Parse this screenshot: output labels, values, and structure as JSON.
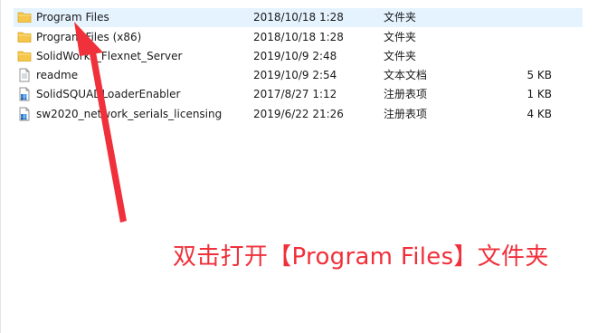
{
  "files": [
    {
      "name": "Program Files",
      "date": "2018/10/18 1:28",
      "type": "文件夹",
      "size": "",
      "icon": "folder-icon",
      "selected": true
    },
    {
      "name": "Program Files (x86)",
      "date": "2018/10/18 1:28",
      "type": "文件夹",
      "size": "",
      "icon": "folder-icon"
    },
    {
      "name": "SolidWorks_Flexnet_Server",
      "date": "2019/10/9 2:48",
      "type": "文件夹",
      "size": "",
      "icon": "folder-icon"
    },
    {
      "name": "readme",
      "date": "2019/10/9 2:54",
      "type": "文本文档",
      "size": "5 KB",
      "icon": "text-file-icon"
    },
    {
      "name": "SolidSQUADLoaderEnabler",
      "date": "2017/8/27 1:12",
      "type": "注册表项",
      "size": "1 KB",
      "icon": "registry-file-icon"
    },
    {
      "name": "sw2020_network_serials_licensing",
      "date": "2019/6/22 21:26",
      "type": "注册表项",
      "size": "4 KB",
      "icon": "registry-file-icon"
    }
  ],
  "annotation": {
    "text": "双击打开【Program Files】文件夹",
    "color": "#f0303a"
  },
  "colors": {
    "selection": "#e5f3ff",
    "folder": "#f5c64a",
    "arrow": "#f0303a"
  }
}
